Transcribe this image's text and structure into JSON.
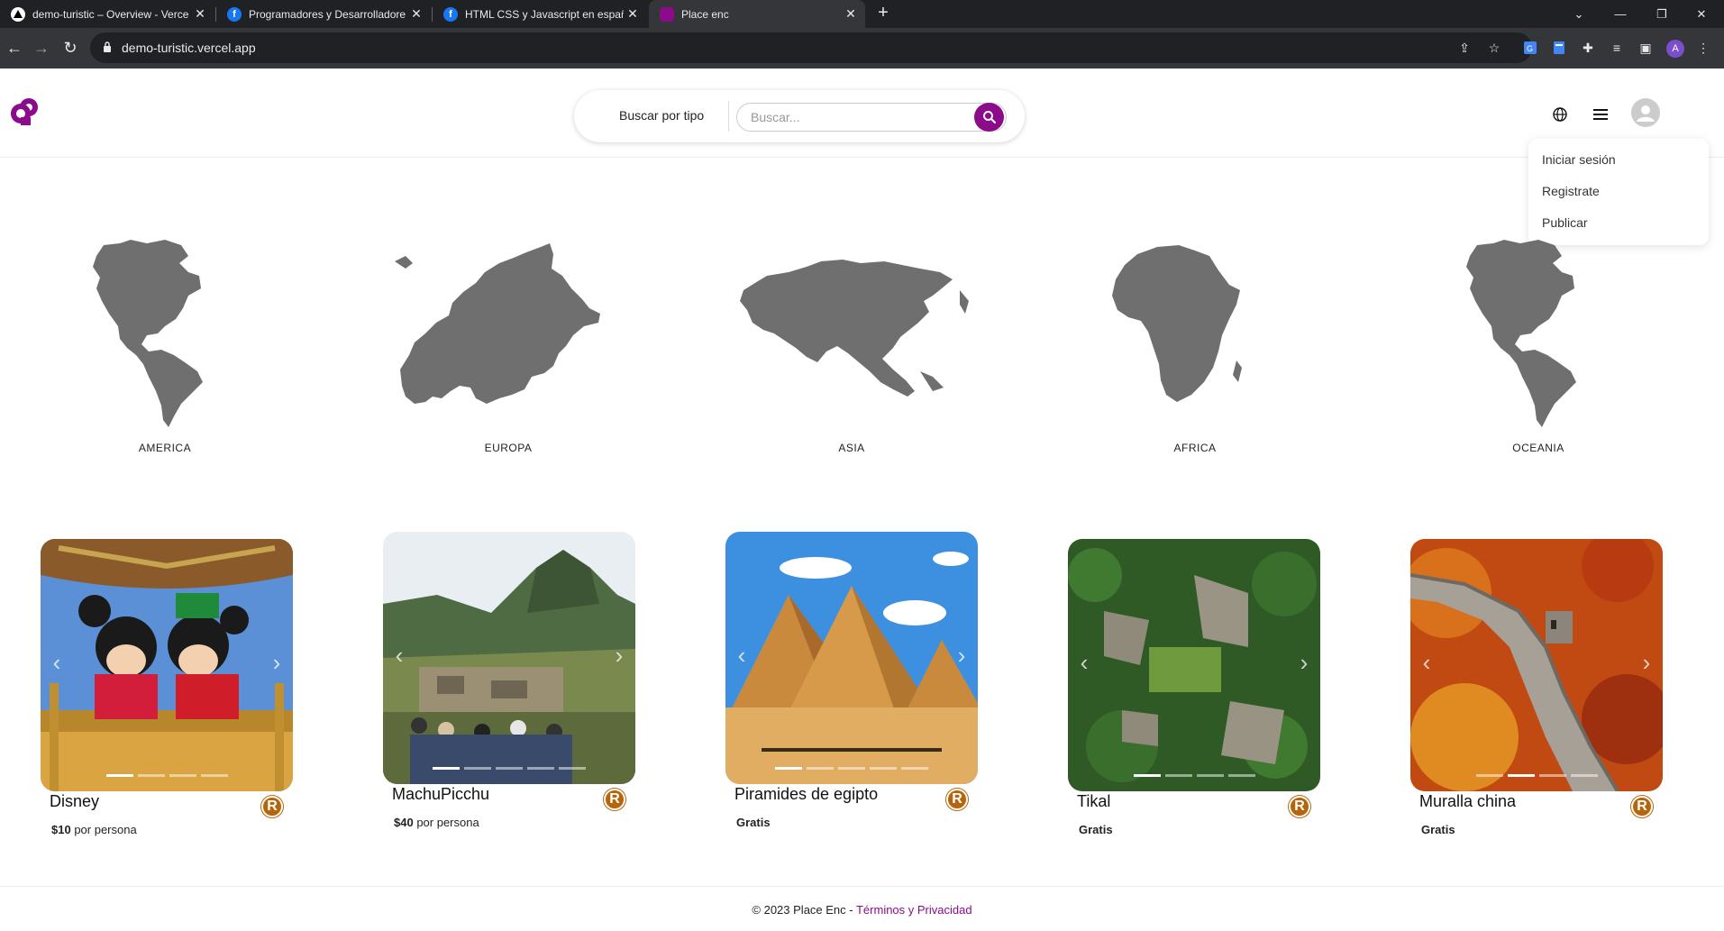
{
  "browser": {
    "tabs": [
      {
        "title": "demo-turistic – Overview - Verce",
        "icon": "vercel-icon"
      },
      {
        "title": "Programadores y Desarrolladore",
        "icon": "facebook-icon"
      },
      {
        "title": "HTML CSS y Javascript en españ",
        "icon": "facebook-icon"
      },
      {
        "title": "Place enc",
        "icon": "place-enc-icon"
      }
    ],
    "url": "demo-turistic.vercel.app",
    "profile_initial": "A"
  },
  "header": {
    "search_type_label": "Buscar por tipo",
    "search_placeholder": "Buscar...",
    "menu": [
      "Iniciar sesión",
      "Registrate",
      "Publicar"
    ]
  },
  "continents": [
    "AMERICA",
    "EUROPA",
    "ASIA",
    "AFRICA",
    "OCEANIA"
  ],
  "places": [
    {
      "name": "Disney",
      "price_amount": "$10",
      "price_unit": " por persona",
      "badge": "R",
      "slides": 4,
      "active_slide": 0
    },
    {
      "name": "MachuPicchu",
      "price_amount": "$40",
      "price_unit": " por persona",
      "badge": "R",
      "slides": 5,
      "active_slide": 0
    },
    {
      "name": "Piramides de egipto",
      "price_amount": "Gratis",
      "price_unit": "",
      "badge": "R",
      "slides": 5,
      "active_slide": 0
    },
    {
      "name": "Tikal",
      "price_amount": "Gratis",
      "price_unit": "",
      "badge": "R",
      "slides": 4,
      "active_slide": 0
    },
    {
      "name": "Muralla china",
      "price_amount": "Gratis",
      "price_unit": "",
      "badge": "R",
      "slides": 4,
      "active_slide": 1
    }
  ],
  "footer": {
    "copyright": "© 2023 Place Enc - ",
    "link": "Términos y Privacidad"
  },
  "colors": {
    "brand": "#8b0b8b",
    "badge": "#b7650c",
    "map": "#6f6f6f"
  }
}
